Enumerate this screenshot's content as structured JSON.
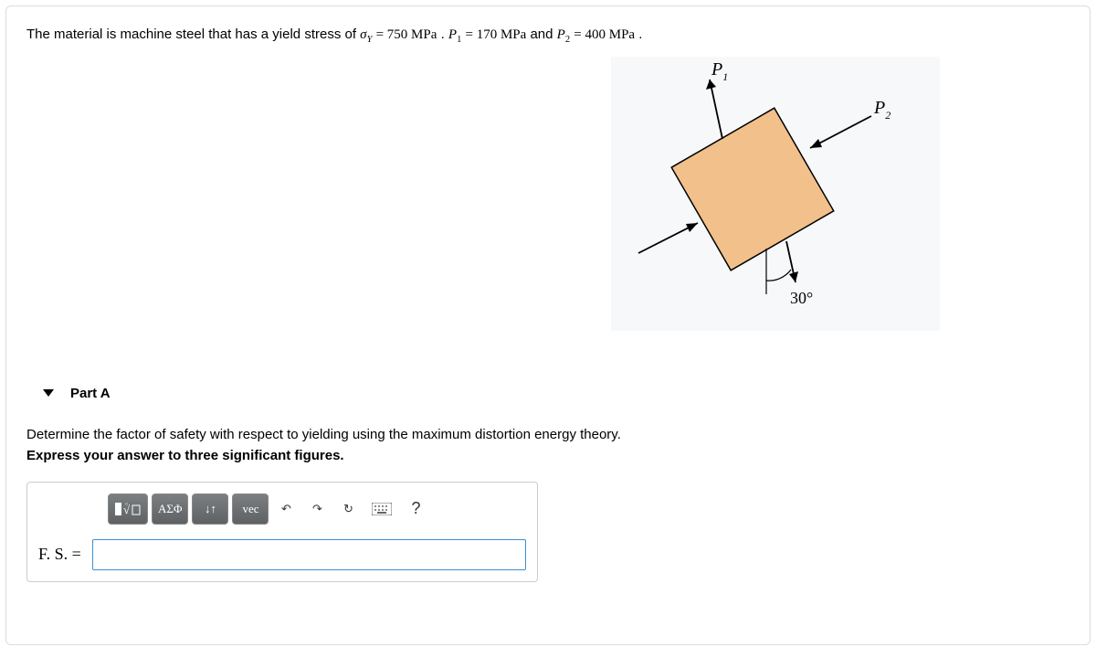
{
  "problem": {
    "prefix": "The material is machine steel that has a yield stress of ",
    "sigma_eq": "σ",
    "sigma_sub": "Y",
    "sigma_val": " = 750 MPa",
    "mid1": " . ",
    "p1_var": "P",
    "p1_sub": "1",
    "p1_val": " = 170 MPa",
    "mid2": " and ",
    "p2_var": "P",
    "p2_sub": "2",
    "p2_val": " = 400 MPa",
    "suffix": " ."
  },
  "diagram": {
    "p1_label": "P",
    "p1_sub": "1",
    "p2_label": "P",
    "p2_sub": "2",
    "angle": "30°"
  },
  "part": {
    "title": "Part A",
    "question": "Determine the factor of safety with respect to yielding using the maximum distortion energy theory.",
    "instruction": "Express your answer to three significant figures."
  },
  "toolbar": {
    "templates": "▮√▫",
    "greek": "ΑΣΦ",
    "subsup": "↓↑",
    "vec": "vec",
    "undo": "↶",
    "redo": "↷",
    "reset": "↻",
    "keyboard": "⌨",
    "help": "?"
  },
  "answer": {
    "label": "F. S. =",
    "value": ""
  }
}
